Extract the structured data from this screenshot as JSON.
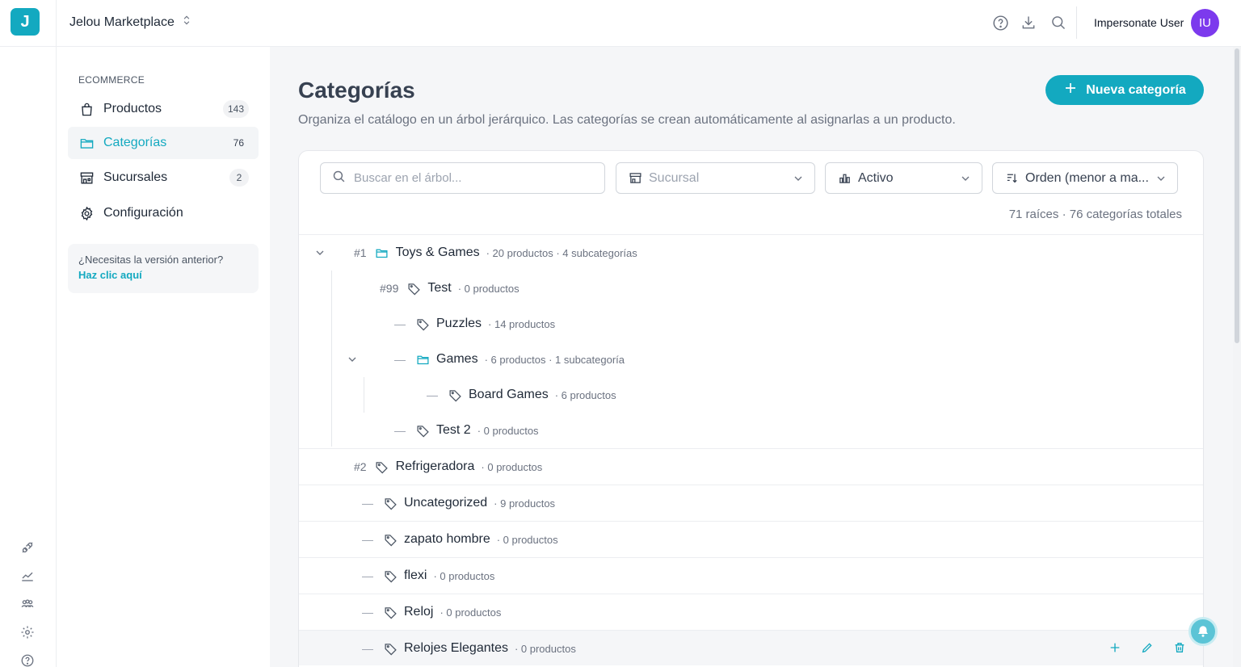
{
  "app": {
    "logo_letter": "J",
    "workspace": "Jelou Marketplace",
    "user_name": "Impersonate User",
    "avatar_initials": "IU"
  },
  "colors": {
    "accent": "#13a9c0",
    "avatar": "#7c3aed"
  },
  "sidebar": {
    "section": "ECOMMERCE",
    "items": [
      {
        "label": "Productos",
        "count": "143",
        "icon": "bag-icon"
      },
      {
        "label": "Categorías",
        "count": "76",
        "icon": "folder-icon",
        "active": true
      },
      {
        "label": "Sucursales",
        "count": "2",
        "icon": "store-icon"
      },
      {
        "label": "Configuración",
        "count": "",
        "icon": "gear-icon"
      }
    ],
    "legacy_question": "¿Necesitas la versión anterior?",
    "legacy_link": "Haz clic aquí"
  },
  "main": {
    "title": "Categorías",
    "description": "Organiza el catálogo en un árbol jerárquico. Las categorías se crean automáticamente al asignarlas a un producto.",
    "new_button": "Nueva categoría",
    "search_placeholder": "Buscar en el árbol...",
    "filters": {
      "branch": "Sucursal",
      "status": "Activo",
      "order": "Orden (menor a ma..."
    },
    "summary": "71 raíces · 76 categorías totales"
  },
  "tree": [
    {
      "num": "#1",
      "name": "Toys & Games",
      "meta": "· 20 productos · 4 subcategorías",
      "type": "folder"
    },
    {
      "num": "#99",
      "name": "Test",
      "meta": "· 0 productos",
      "type": "tag"
    },
    {
      "num": "",
      "name": "Puzzles",
      "meta": "· 14 productos",
      "type": "tag"
    },
    {
      "num": "",
      "name": "Games",
      "meta": "· 6 productos · 1 subcategoría",
      "type": "folder"
    },
    {
      "num": "",
      "name": "Board Games",
      "meta": "· 6 productos",
      "type": "tag"
    },
    {
      "num": "",
      "name": "Test 2",
      "meta": "· 0 productos",
      "type": "tag"
    },
    {
      "num": "#2",
      "name": "Refrigeradora",
      "meta": "· 0 productos",
      "type": "tag"
    },
    {
      "num": "",
      "name": "Uncategorized",
      "meta": "· 9 productos",
      "type": "tag"
    },
    {
      "num": "",
      "name": "zapato hombre",
      "meta": "· 0 productos",
      "type": "tag"
    },
    {
      "num": "",
      "name": "flexi",
      "meta": "· 0 productos",
      "type": "tag"
    },
    {
      "num": "",
      "name": "Reloj",
      "meta": "· 0 productos",
      "type": "tag"
    },
    {
      "num": "",
      "name": "Relojes Elegantes",
      "meta": "· 0 productos",
      "type": "tag"
    }
  ]
}
